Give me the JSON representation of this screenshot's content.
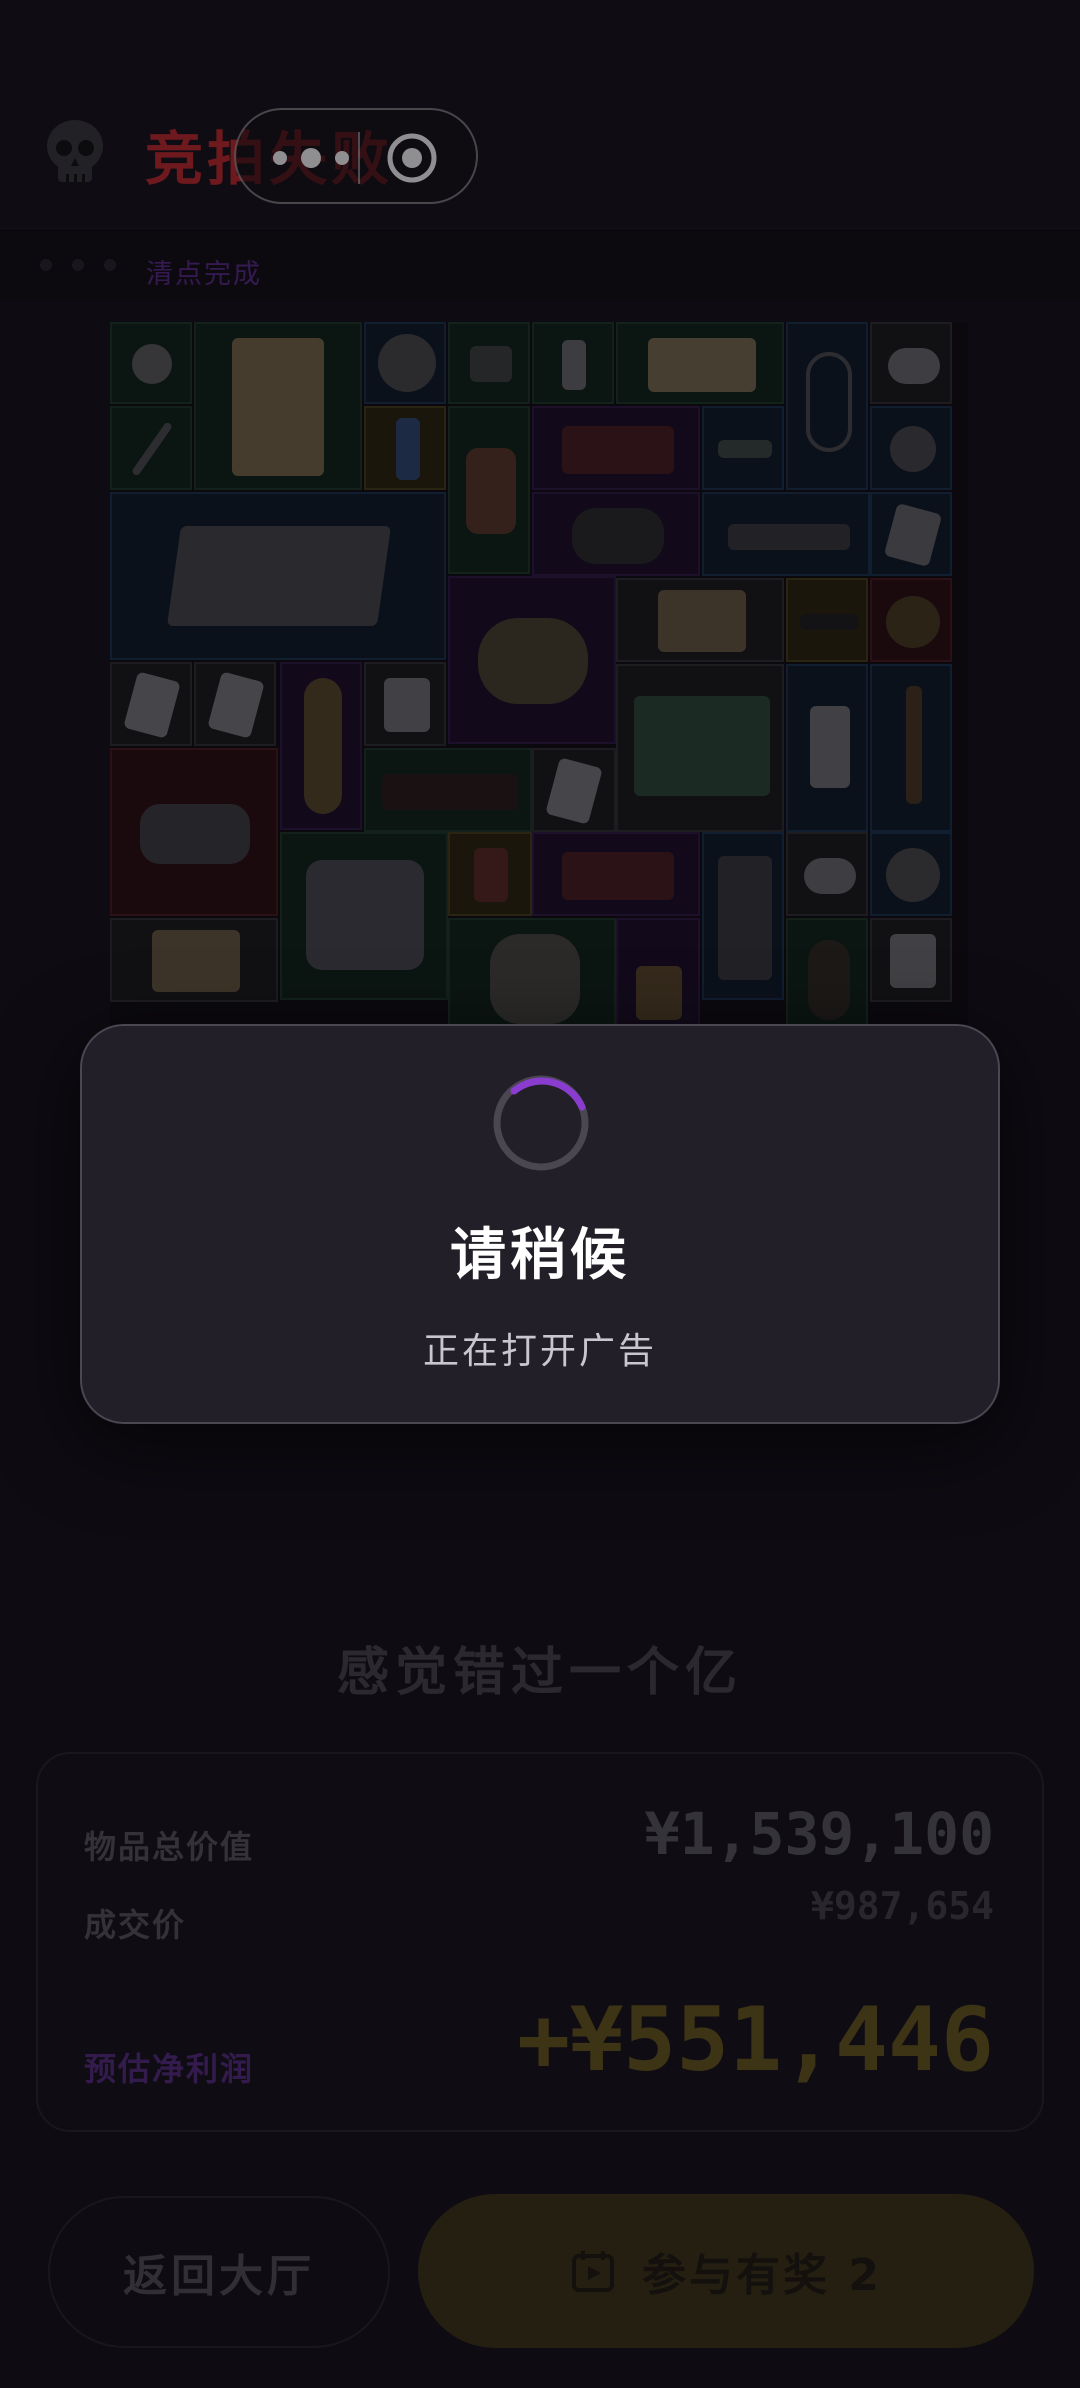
{
  "header": {
    "title": "竞拍失败",
    "title_color": "#c42a2e",
    "skull_icon": "skull-icon",
    "capsule": {
      "more_icon": "more-dots-icon",
      "close_icon": "target-close-icon"
    }
  },
  "subbar": {
    "text": "清点完成",
    "progress_dots": 3
  },
  "grid": {
    "items": [
      "fan-icon",
      "painting-icon",
      "coin-icon",
      "circuit-icon",
      "lighter-icon",
      "document-icon",
      "stethoscope-icon",
      "mouse-icon",
      "pen-icon",
      "trophy-icon",
      "drum-icon",
      "gpu-icon",
      "ssd-icon",
      "disk-icon",
      "solar-panel-icon",
      "lens-icon",
      "gun-icon",
      "box-icon",
      "card-icon",
      "saw-icon",
      "photo-icon",
      "bar-icon",
      "watch-icon",
      "hookah-icon",
      "cards-icon",
      "drone-icon",
      "plank-icon",
      "milk-box-icon",
      "moka-pot-icon",
      "spyglass-icon",
      "rack-icon",
      "medal-icon",
      "sphinx-icon",
      "atm-icon",
      "mask-icon"
    ]
  },
  "subheading": "感觉错过一个亿",
  "stats": {
    "total_label": "物品总价值",
    "total_value": "¥1,539,100",
    "deal_label": "成交价",
    "deal_value": "¥987,654",
    "profit_label": "预估净利润",
    "profit_value": "+¥551,446",
    "profit_color": "#f2c33a"
  },
  "buttons": {
    "back_label": "返回大厅",
    "reward_label": "参与有奖 2",
    "reward_icon": "video-ad-icon"
  },
  "modal": {
    "spinner_icon": "loading-spinner-icon",
    "title": "请稍候",
    "message": "正在打开广告"
  }
}
